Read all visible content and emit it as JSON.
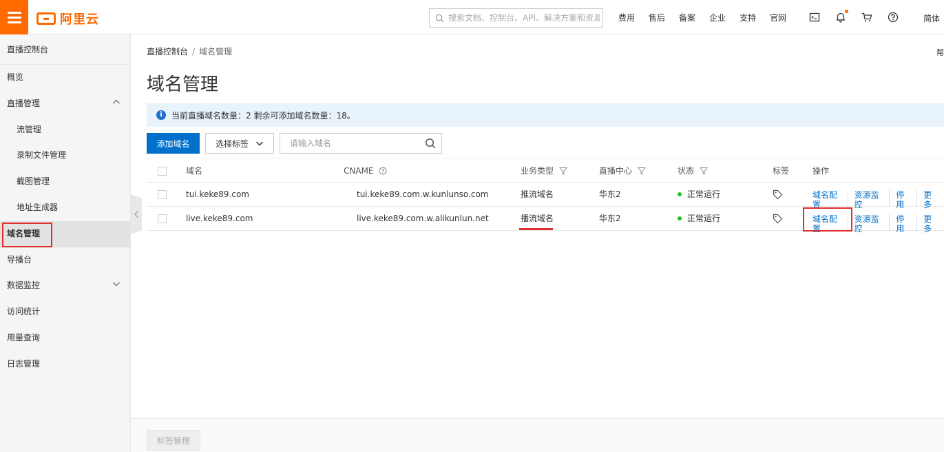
{
  "header": {
    "logo_text": "阿里云",
    "search_placeholder": "搜索文档、控制台、API、解决方案和资源",
    "nav": [
      "费用",
      "售后",
      "备案",
      "企业",
      "支持",
      "官网"
    ],
    "lang": "简体"
  },
  "sidebar": {
    "title": "直播控制台",
    "items": [
      {
        "label": "概览"
      },
      {
        "label": "直播管理"
      },
      {
        "label": "流管理"
      },
      {
        "label": "录制文件管理"
      },
      {
        "label": "截图管理"
      },
      {
        "label": "地址生成器"
      },
      {
        "label": "域名管理"
      },
      {
        "label": "导播台"
      },
      {
        "label": "数据监控"
      },
      {
        "label": "访问统计"
      },
      {
        "label": "用量查询"
      },
      {
        "label": "日志管理"
      }
    ]
  },
  "main": {
    "breadcrumb_root": "直播控制台",
    "breadcrumb_sep": "/",
    "breadcrumb_current": "域名管理",
    "help": "帮",
    "title": "域名管理",
    "notice": "当前直播域名数量：2 剩余可添加域名数量：18。",
    "add_button": "添加域名",
    "tag_select": "选择标签",
    "domain_search_placeholder": "请输入域名"
  },
  "table": {
    "headers": {
      "domain": "域名",
      "cname": "CNAME",
      "biz_type": "业务类型",
      "center": "直播中心",
      "status": "状态",
      "tag": "标签",
      "ops": "操作"
    },
    "rows": [
      {
        "domain": "tui.keke89.com",
        "cname": "tui.keke89.com.w.kunlunso.com",
        "biz_type": "推流域名",
        "center": "华东2",
        "status": "正常运行",
        "op1": "域名配置",
        "op2": "资源监控",
        "op3": "停用",
        "op4": "更多"
      },
      {
        "domain": "live.keke89.com",
        "cname": "live.keke89.com.w.alikunlun.net",
        "biz_type": "播流域名",
        "center": "华东2",
        "status": "正常运行",
        "op1": "域名配置",
        "op2": "资源监控",
        "op3": "停用",
        "op4": "更多"
      }
    ]
  },
  "footer": {
    "tag_manage": "标签管理"
  },
  "colors": {
    "brand": "#ff6a00",
    "link": "#0070cc",
    "highlight": "#e12e2e",
    "status_ok": "#1dc11d"
  }
}
